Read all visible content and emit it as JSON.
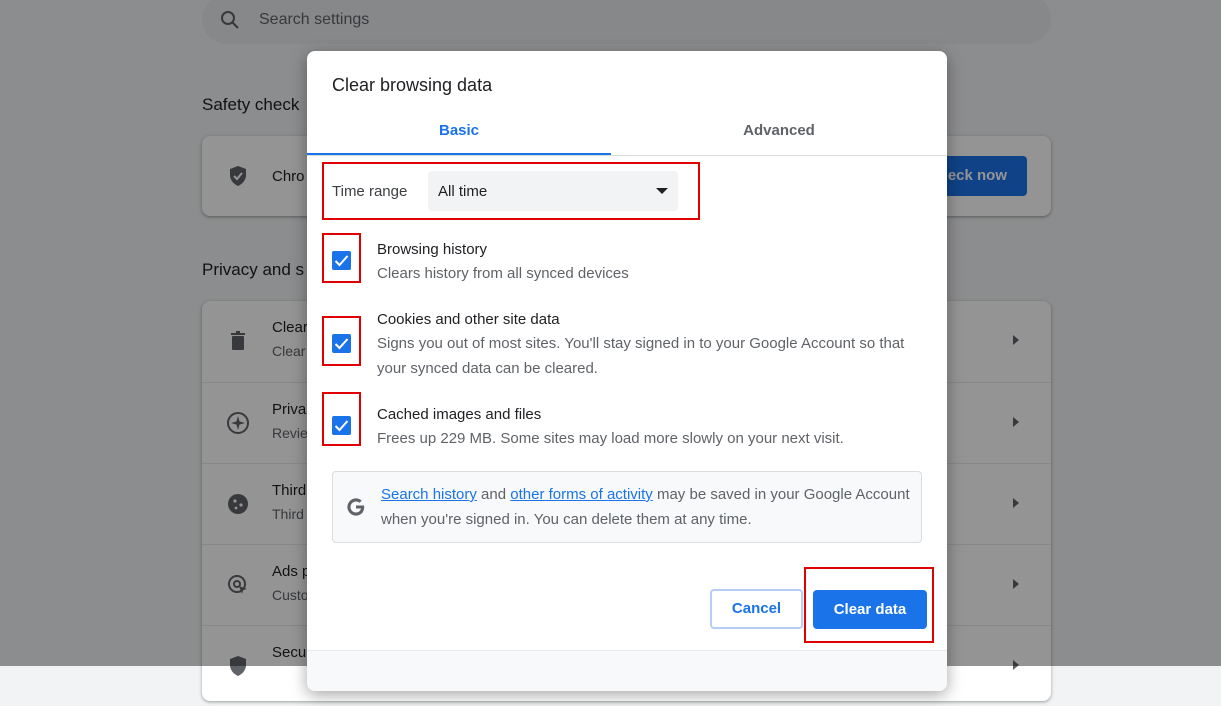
{
  "background": {
    "search_placeholder": "Search settings",
    "safety_check": {
      "section_title": "Safety check",
      "row_text": "Chro",
      "check_now_label": "eck now"
    },
    "privacy": {
      "section_title": "Privacy and s",
      "rows": [
        {
          "title": "Clear",
          "subtitle": "Clear",
          "icon": "trash-icon"
        },
        {
          "title": "Priva",
          "subtitle": "Revie",
          "icon": "compass-icon"
        },
        {
          "title": "Third",
          "subtitle": "Third",
          "icon": "cookie-icon"
        },
        {
          "title": "Ads p",
          "subtitle": "Custo",
          "icon": "ads-icon"
        },
        {
          "title": "Secu",
          "subtitle": "",
          "icon": "shield-icon"
        }
      ]
    }
  },
  "dialog": {
    "title": "Clear browsing data",
    "tabs": [
      {
        "label": "Basic",
        "active": true
      },
      {
        "label": "Advanced",
        "active": false
      }
    ],
    "time_range": {
      "label": "Time range",
      "value": "All time"
    },
    "options": [
      {
        "title": "Browsing history",
        "description": "Clears history from all synced devices",
        "checked": true
      },
      {
        "title": "Cookies and other site data",
        "description": "Signs you out of most sites. You'll stay signed in to your Google Account so that your synced data can be cleared.",
        "checked": true
      },
      {
        "title": "Cached images and files",
        "description": "Frees up 229 MB. Some sites may load more slowly on your next visit.",
        "checked": true
      }
    ],
    "google_notice": {
      "link1": "Search history",
      "and": "and",
      "link2": "other forms of activity",
      "rest": "may be saved in your Google Account when you're signed in. You can delete them at any time."
    },
    "buttons": {
      "cancel": "Cancel",
      "clear": "Clear data"
    }
  },
  "colors": {
    "accent": "#1a73e8",
    "highlight": "#e00000"
  }
}
